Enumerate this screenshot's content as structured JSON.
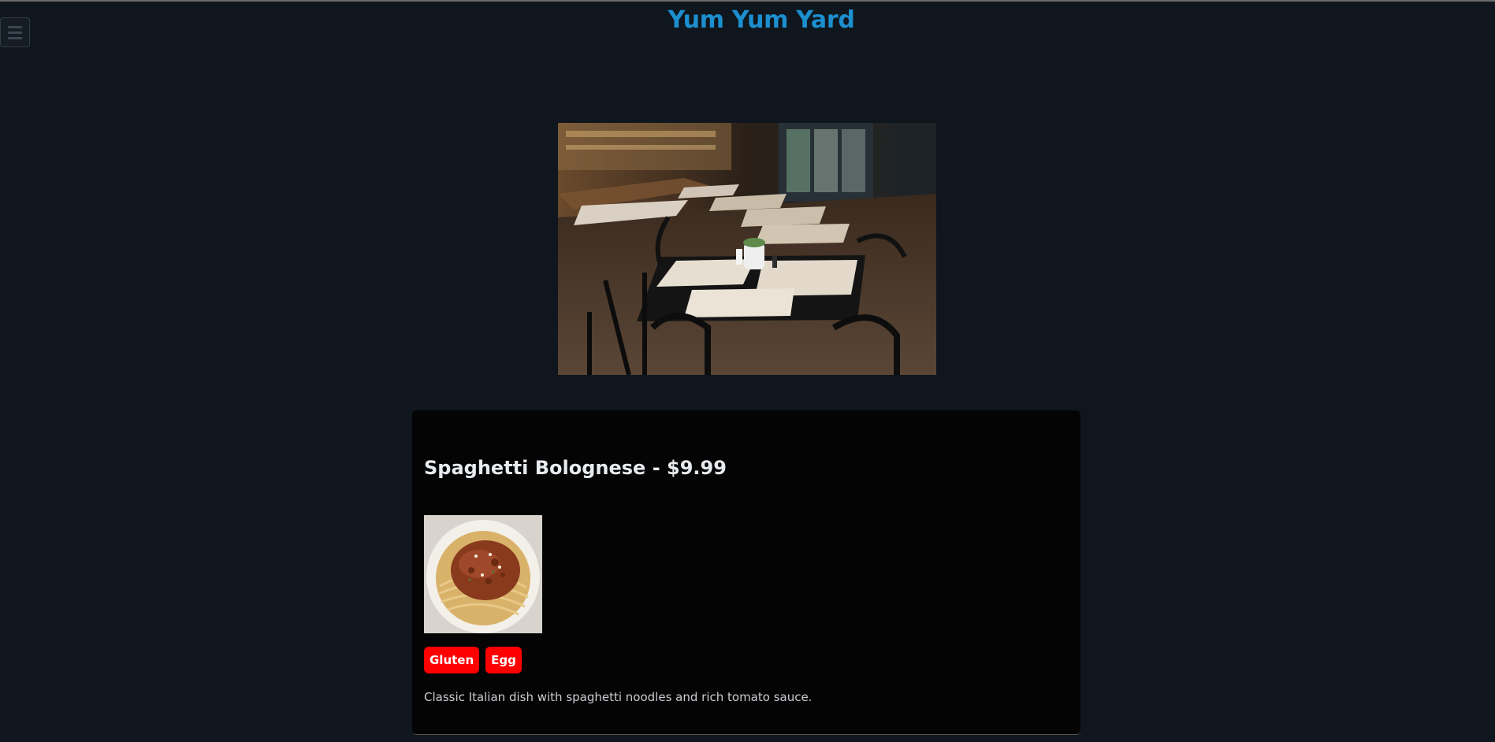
{
  "site": {
    "title": "Yum Yum Yard"
  },
  "icons": {
    "menu": "hamburger-menu-icon"
  },
  "hero_image": {
    "subject": "restaurant interior with tables and chairs"
  },
  "menu_item": {
    "title": "Spaghetti Bolognese - $9.99",
    "photo_subject": "plate of spaghetti bolognese",
    "tags": [
      "Gluten",
      "Egg"
    ],
    "description": "Classic Italian dish with spaghetti noodles and rich tomato sauce."
  },
  "colors": {
    "page_bg": "#0f161d",
    "title": "#1c8fcf",
    "card_bg": "#040404",
    "tag_bg": "#ff0000"
  }
}
